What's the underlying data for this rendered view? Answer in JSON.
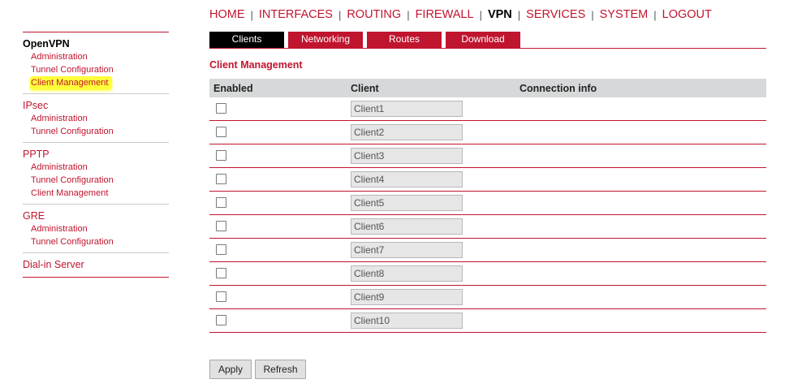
{
  "topnav": {
    "items": [
      {
        "label": "HOME"
      },
      {
        "label": "INTERFACES"
      },
      {
        "label": "ROUTING"
      },
      {
        "label": "FIREWALL"
      },
      {
        "label": "VPN",
        "active": true
      },
      {
        "label": "SERVICES"
      },
      {
        "label": "SYSTEM"
      },
      {
        "label": "LOGOUT"
      }
    ],
    "separator": "|"
  },
  "sidebar": {
    "groups": [
      {
        "title": "OpenVPN",
        "active": true,
        "items": [
          "Administration",
          "Tunnel Configuration",
          "Client Management"
        ],
        "current_item": "Client Management"
      },
      {
        "title": "IPsec",
        "items": [
          "Administration",
          "Tunnel Configuration"
        ]
      },
      {
        "title": "PPTP",
        "items": [
          "Administration",
          "Tunnel Configuration",
          "Client Management"
        ]
      },
      {
        "title": "GRE",
        "items": [
          "Administration",
          "Tunnel Configuration"
        ]
      },
      {
        "title": "Dial-in Server",
        "items": []
      }
    ]
  },
  "tabs": [
    {
      "label": "Clients",
      "active": true
    },
    {
      "label": "Networking"
    },
    {
      "label": "Routes"
    },
    {
      "label": "Download"
    }
  ],
  "section_title": "Client Management",
  "table": {
    "headers": {
      "enabled": "Enabled",
      "client": "Client",
      "connection": "Connection info"
    },
    "rows": [
      {
        "enabled": false,
        "client": "Client1",
        "connection": ""
      },
      {
        "enabled": false,
        "client": "Client2",
        "connection": ""
      },
      {
        "enabled": false,
        "client": "Client3",
        "connection": ""
      },
      {
        "enabled": false,
        "client": "Client4",
        "connection": ""
      },
      {
        "enabled": false,
        "client": "Client5",
        "connection": ""
      },
      {
        "enabled": false,
        "client": "Client6",
        "connection": ""
      },
      {
        "enabled": false,
        "client": "Client7",
        "connection": ""
      },
      {
        "enabled": false,
        "client": "Client8",
        "connection": ""
      },
      {
        "enabled": false,
        "client": "Client9",
        "connection": ""
      },
      {
        "enabled": false,
        "client": "Client10",
        "connection": ""
      }
    ]
  },
  "buttons": {
    "apply": "Apply",
    "refresh": "Refresh"
  },
  "colors": {
    "accent": "#c0152f",
    "tab_active": "#000000",
    "header_bg": "#d6d9d9",
    "highlight": "#ffff3a"
  }
}
